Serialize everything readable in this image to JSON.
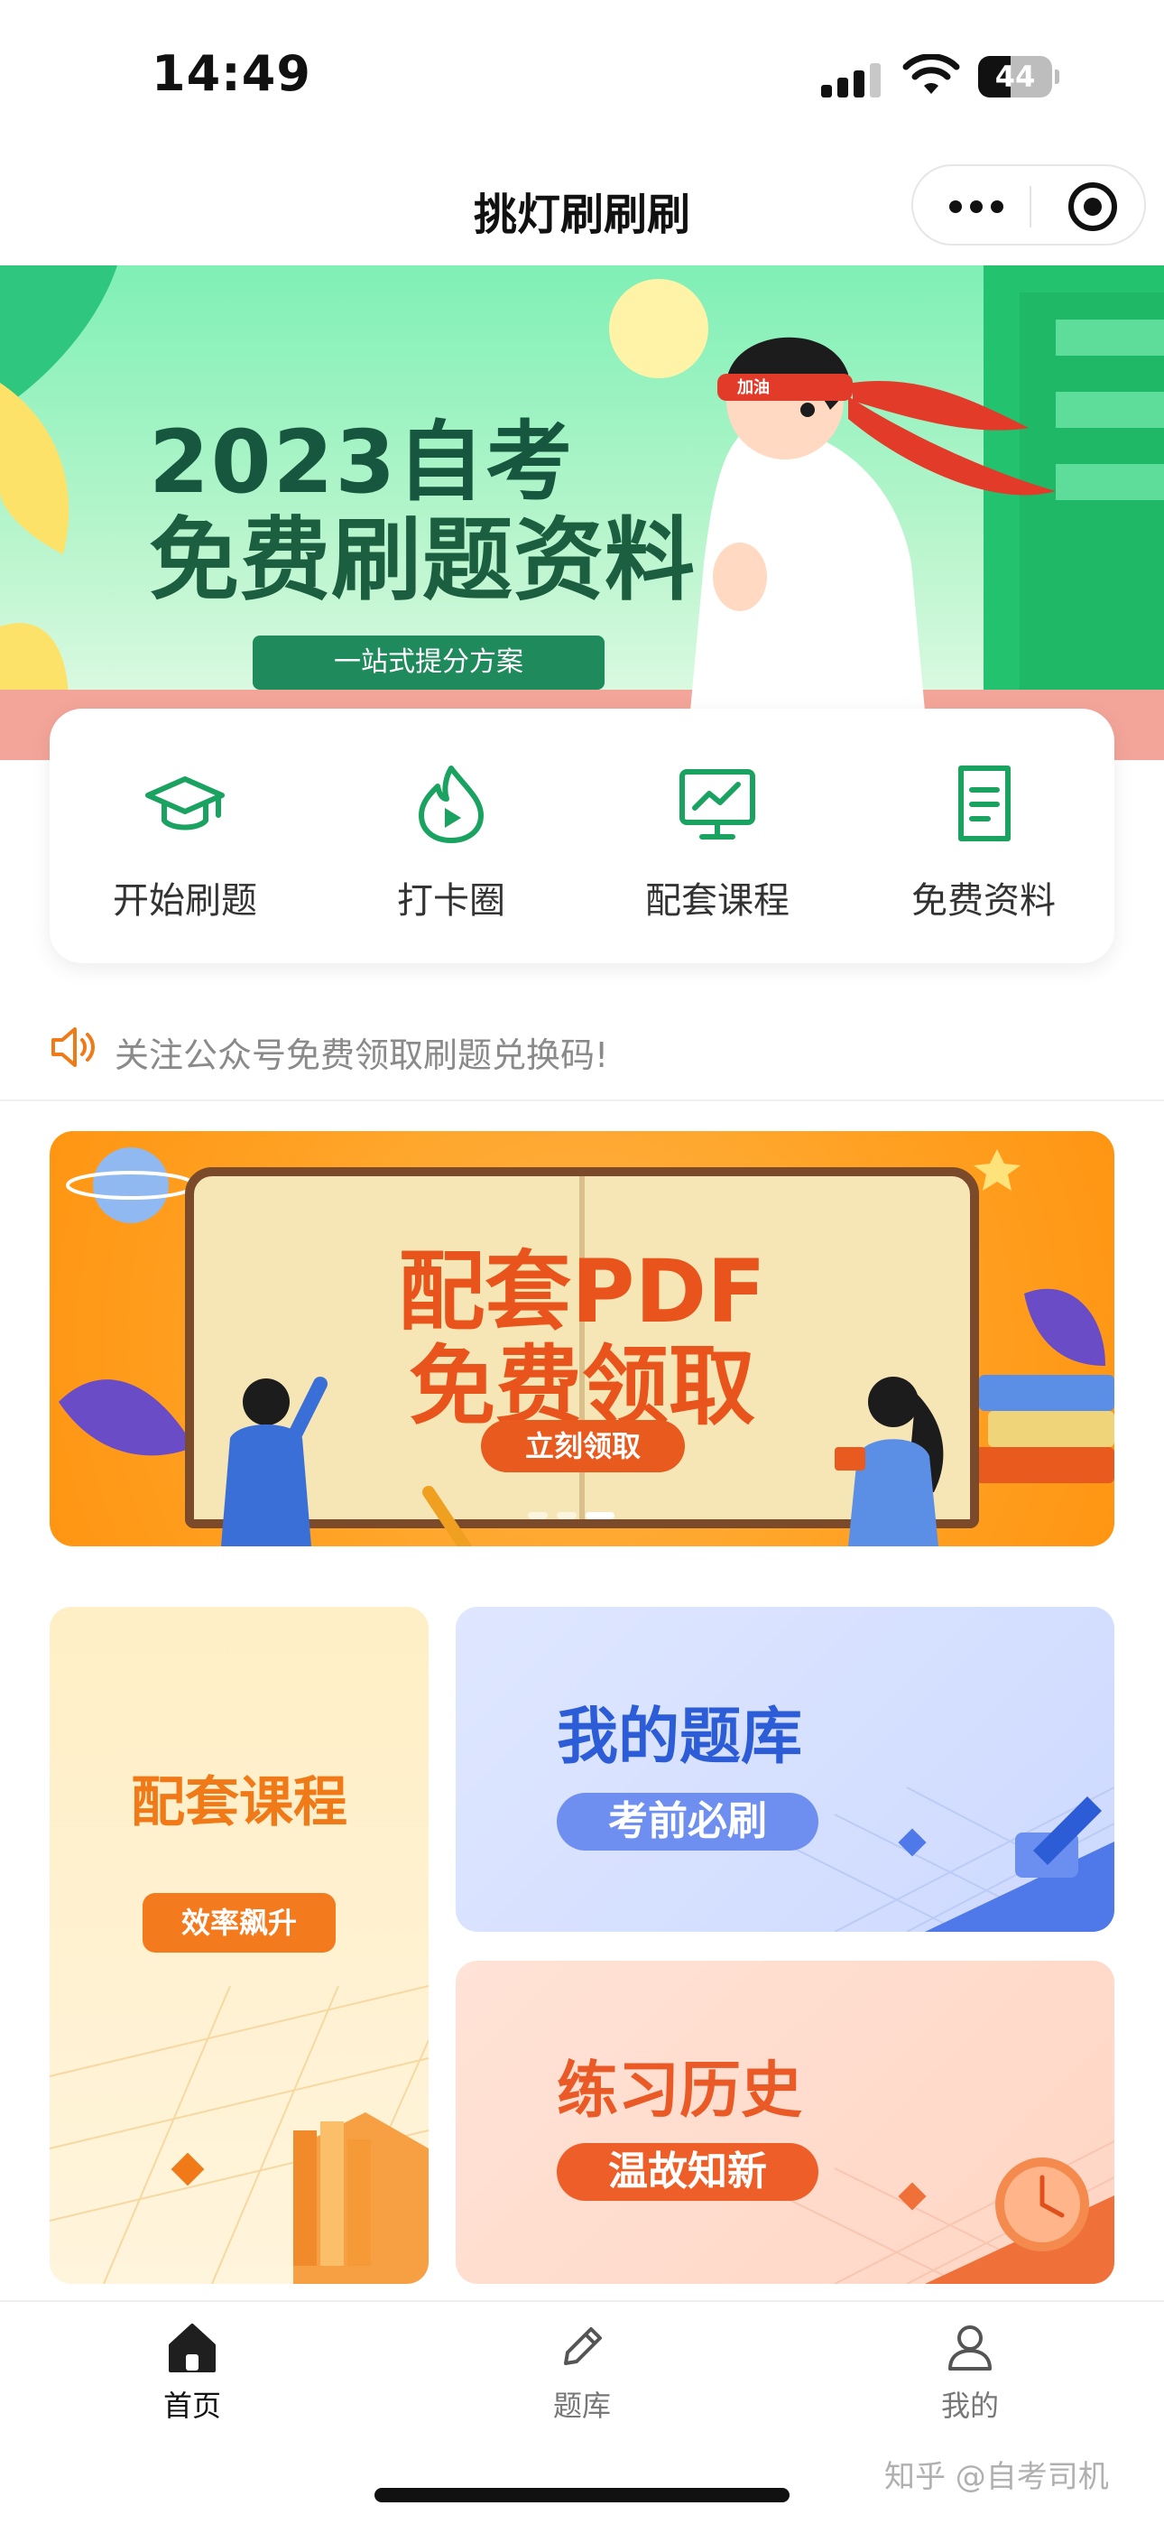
{
  "status_bar": {
    "time": "14:49",
    "battery": "44",
    "battery_level": 0.44
  },
  "nav": {
    "title": "挑灯刷刷刷"
  },
  "hero": {
    "title": "2023自考",
    "subtitle": "免费刷题资料",
    "tagline": "一站式提分方案",
    "badge": "加油"
  },
  "quick_menu": [
    {
      "label": "开始刷题",
      "icon": "graduation-cap-icon"
    },
    {
      "label": "打卡圈",
      "icon": "flame-play-icon"
    },
    {
      "label": "配套课程",
      "icon": "monitor-chart-icon"
    },
    {
      "label": "免费资料",
      "icon": "document-icon"
    }
  ],
  "notice": {
    "text": "关注公众号免费领取刷题兑换码!",
    "icon": "speaker-icon"
  },
  "pdf_banner": {
    "title": "配套PDF",
    "subtitle": "免费领取",
    "cta": "立刻领取",
    "dots": 3,
    "active_dot": 2
  },
  "cards": {
    "course": {
      "title": "配套课程",
      "chip": "效率飙升"
    },
    "bank": {
      "title": "我的题库",
      "chip": "考前必刷"
    },
    "history": {
      "title": "练习历史",
      "chip": "温故知新"
    }
  },
  "tab_bar": [
    {
      "label": "首页",
      "icon": "home-icon",
      "active": true
    },
    {
      "label": "题库",
      "icon": "pencil-icon",
      "active": false
    },
    {
      "label": "我的",
      "icon": "user-icon",
      "active": false
    }
  ],
  "watermark": "知乎 @自考司机",
  "colors": {
    "primary_green": "#1aa260",
    "accent_orange": "#f07a17",
    "bank_blue": "#2c5cd6",
    "history_red": "#ea5a26"
  }
}
